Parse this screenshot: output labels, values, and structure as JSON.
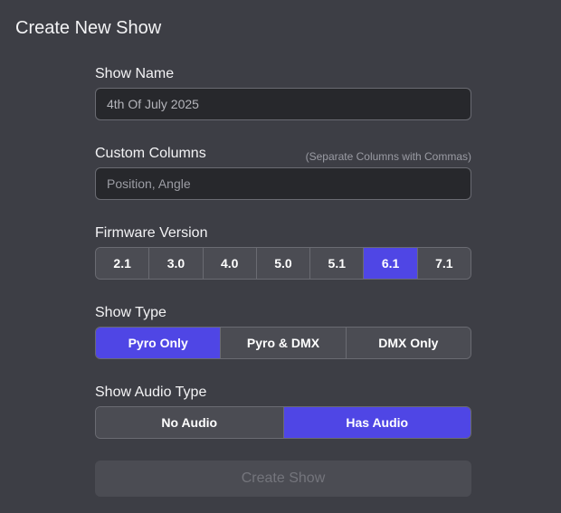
{
  "dialog": {
    "title": "Create New Show"
  },
  "show_name": {
    "label": "Show Name",
    "value": "4th Of July 2025"
  },
  "custom_columns": {
    "label": "Custom Columns",
    "hint": "(Separate Columns with Commas)",
    "placeholder": "Position, Angle"
  },
  "firmware": {
    "label": "Firmware Version",
    "options": [
      "2.1",
      "3.0",
      "4.0",
      "5.0",
      "5.1",
      "6.1",
      "7.1"
    ],
    "selected": "6.1"
  },
  "show_type": {
    "label": "Show Type",
    "options": [
      "Pyro Only",
      "Pyro & DMX",
      "DMX Only"
    ],
    "selected": "Pyro Only"
  },
  "audio_type": {
    "label": "Show Audio Type",
    "options": [
      "No Audio",
      "Has Audio"
    ],
    "selected": "Has Audio"
  },
  "submit": {
    "label": "Create Show",
    "disabled": true
  },
  "colors": {
    "background": "#3d3e45",
    "accent": "#4f46e5",
    "input_bg": "#27282c",
    "segment_bg": "#4b4c53"
  }
}
